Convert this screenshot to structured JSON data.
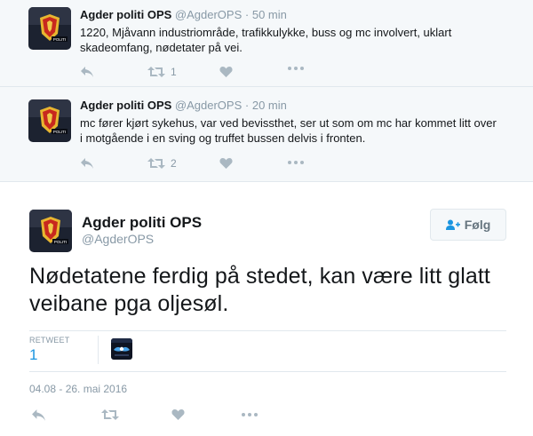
{
  "context_tweets": [
    {
      "name": "Agder politi OPS",
      "handle": "@AgderOPS",
      "separator": "·",
      "time": "50 min",
      "text": "1220, Mjåvann industriområde, trafikkulykke, buss og mc involvert, uklart skadeomfang, nødetater på vei.",
      "retweet_count": "1"
    },
    {
      "name": "Agder politi OPS",
      "handle": "@AgderOPS",
      "separator": "·",
      "time": "20 min",
      "text": "mc fører kjørt sykehus, var ved bevissthet, ser ut som om mc har kommet litt over i motgående i en sving og truffet bussen delvis i fronten.",
      "retweet_count": "2"
    }
  ],
  "main_tweet": {
    "name": "Agder politi OPS",
    "handle": "@AgderOPS",
    "follow_label": "Følg",
    "text": "Nødetatene ferdig på stedet, kan være litt glatt veibane pga oljesøl.",
    "retweet_label": "RETWEET",
    "retweet_count": "1",
    "timestamp": "04.08 - 26. mai 2016"
  },
  "icons": {
    "reply": "reply-icon",
    "retweet": "retweet-icon",
    "like": "heart-icon",
    "more": "more-dots-icon",
    "follow": "follow-user-icon"
  },
  "colors": {
    "context_background": "#f5f8fa",
    "action_icon": "#aab8c2",
    "link_blue": "#1b95e0",
    "secondary_text": "#8899a6"
  }
}
